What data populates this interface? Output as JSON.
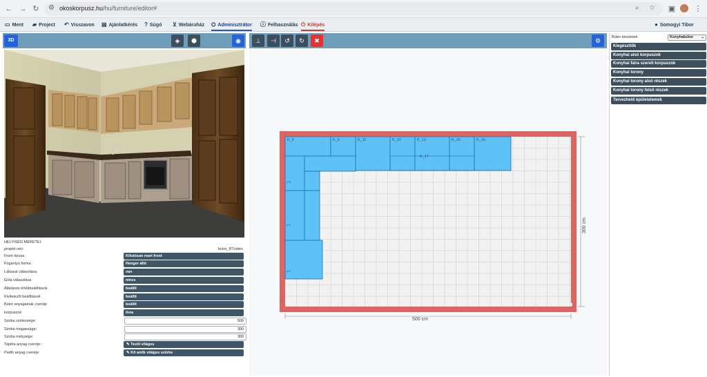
{
  "browser": {
    "url_host": "okoskorpusz.hu",
    "url_path": "/hu/furniture/editor#",
    "icons": [
      "back-icon",
      "forward-icon",
      "reload-icon",
      "tune-icon",
      "zoom-icon",
      "star-icon",
      "sidebar-icon",
      "profile-avatar",
      "menu-dots-icon"
    ]
  },
  "menu": {
    "items": [
      {
        "label": "Ment",
        "icon": "save-icon"
      },
      {
        "label": "Project",
        "icon": "folder-icon"
      },
      {
        "label": "Visszavon",
        "icon": "undo-icon"
      },
      {
        "label": "Ajánlatkérés",
        "icon": "document-icon"
      },
      {
        "label": "Súgó",
        "icon": "help-icon"
      },
      {
        "label": "Webáruház",
        "icon": "cart-icon"
      },
      {
        "label": "Adminisztrátor",
        "icon": "admin-icon"
      },
      {
        "label": "Felhasználás",
        "icon": "info-icon"
      },
      {
        "label": "Kilépés",
        "icon": "logout-icon"
      }
    ],
    "user": "Somogyi Tibor"
  },
  "view3d": {
    "label": "3D"
  },
  "props": {
    "section_title": "HELYISÉG MÉRETEI:",
    "project_label": "projekt név:",
    "project_value": "butor_RTvideo",
    "rows": [
      {
        "label": "Front típusa",
        "value": "Kifutósan mart front"
      },
      {
        "label": "Fogantyú forma",
        "value": "Henger álló"
      },
      {
        "label": "Lábazat választása",
        "value": "van"
      },
      {
        "label": "Gola választása",
        "value": "nincs"
      },
      {
        "label": "Általános értékbeállítások",
        "value": "beállít"
      },
      {
        "label": "Kivitelezői beállítások",
        "value": "beállít"
      },
      {
        "label": "Bútor anyagainak cseréje",
        "value": "beállít"
      },
      {
        "label": "korpuszok",
        "value": "lista"
      }
    ],
    "inputs": [
      {
        "label": "Szoba szélessége:",
        "value": "500"
      },
      {
        "label": "Szoba magassága:",
        "value": "300"
      },
      {
        "label": "Szoba mélysége:",
        "value": "300"
      }
    ],
    "materials": [
      {
        "label": "Tapéta anyag cseréje:",
        "value": "Textil világos"
      },
      {
        "label": "Padló anyag cseréje:",
        "value": "Kő antik világos szürke"
      }
    ]
  },
  "plan": {
    "width_label": "500 cm",
    "height_label": "300 cm",
    "cabinets": [
      "K_5",
      "K_9",
      "K_11",
      "K_12",
      "K_13",
      "K_15",
      "K_16",
      "K_17"
    ],
    "colors": {
      "wall": "#dc6462",
      "cabinet": "#5ec2f7",
      "cabinet_border": "#1e6fa8",
      "grid": "#c8c8c8",
      "floor": "#f2f2f2"
    }
  },
  "sidebar": {
    "set_label": "Bútor készletek",
    "set_select": "Konyhabútor",
    "categories": [
      "Kiegészítők",
      "Konyhai alsó korpuszok",
      "Konyhai falra szerelt korpuszok",
      "Konyhai torony",
      "Konyhai torony alsó részek",
      "Konyhai torony felső részek",
      "Tervezhető épületelemek"
    ]
  }
}
